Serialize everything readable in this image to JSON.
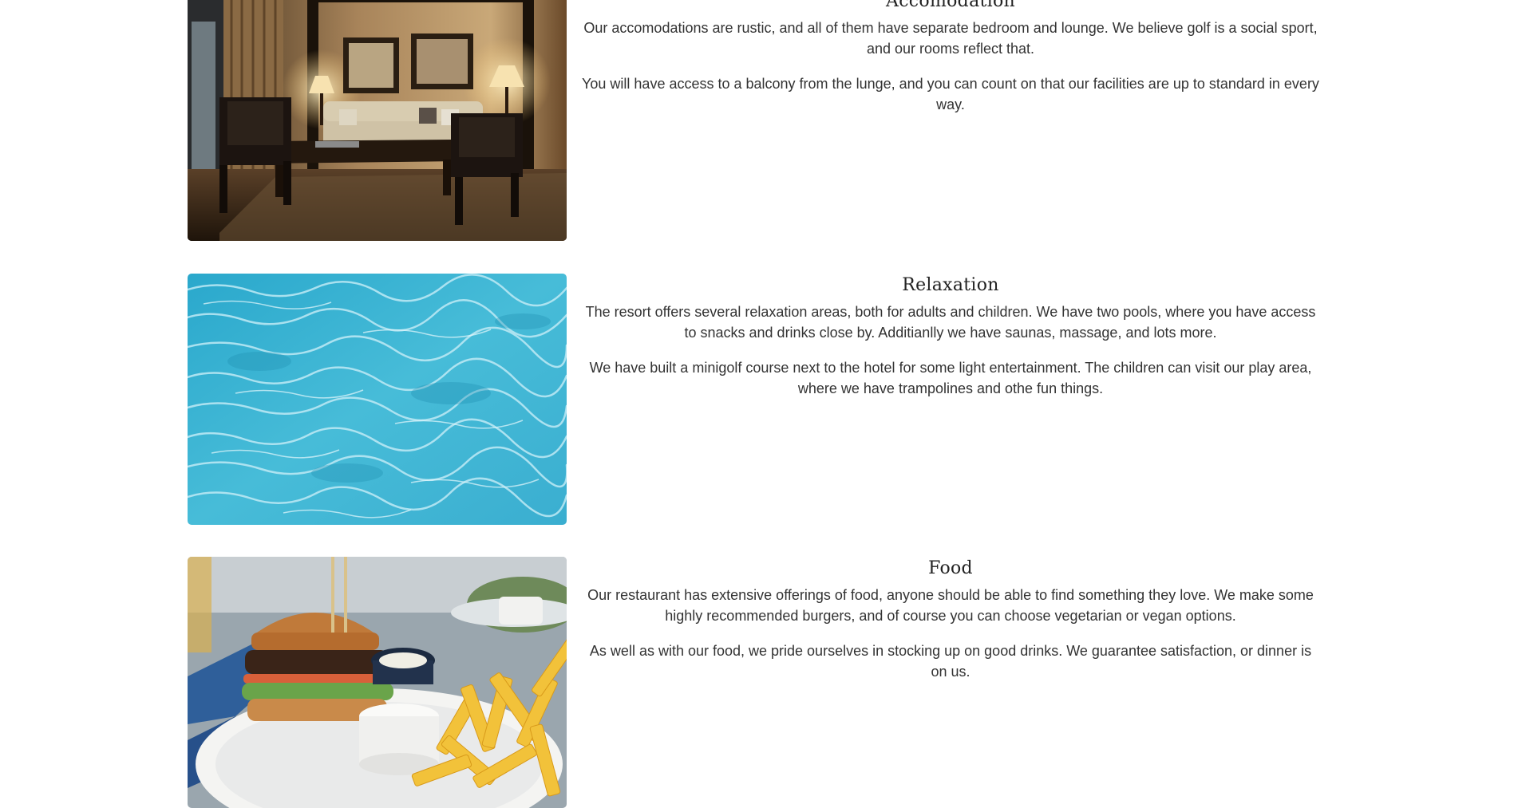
{
  "sections": [
    {
      "title": "Accomodation",
      "paragraphs": [
        "Our accomodations are rustic, and all of them have separate bedroom and lounge. We believe golf is a social sport, and our rooms reflect that.",
        "You will have access to a balcony from the lunge, and you can count on that our facilities are up to standard in every way."
      ],
      "image": "hotel-lounge-room-photo"
    },
    {
      "title": "Relaxation",
      "paragraphs": [
        "The resort offers several relaxation areas, both for adults and children. We have two pools, where you have access to snacks and drinks close by. Additianlly we have saunas, massage, and lots more.",
        "We have built a minigolf course next to the hotel for some light entertainment. The children can visit our play area, where we have trampolines and othe fun things."
      ],
      "image": "pool-water-photo"
    },
    {
      "title": "Food",
      "paragraphs": [
        "Our restaurant has extensive offerings of food, anyone should be able to find something they love. We make some highly recommended burgers, and of course you can choose vegetarian or vegan options.",
        "As well as with our food, we pride ourselves in stocking up on good drinks. We guarantee satisfaction, or dinner is on us."
      ],
      "image": "burger-and-fries-photo"
    }
  ],
  "colors": {
    "text": "#333333",
    "heading": "#222222",
    "background": "#ffffff"
  }
}
